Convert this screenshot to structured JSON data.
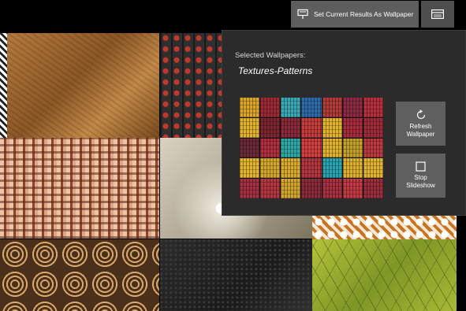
{
  "toolbar": {
    "set_wallpaper_label": "Set Current Results As Wallpaper",
    "set_wallpaper_icon": "monitor-pin-icon",
    "panel_icon": "panel-toggle-icon"
  },
  "flyout": {
    "label": "Selected Wallpapers:",
    "collection_name": "Textures-Patterns",
    "refresh_label": "Refresh Wallpaper",
    "refresh_icon": "refresh-icon",
    "stop_label": "Stop Slideshow",
    "stop_icon": "stop-icon",
    "thumbnail_colors": [
      "#d9a428",
      "#9b2a35",
      "#3aa7b5",
      "#2d6aa8",
      "#b23a3a",
      "#8d2a44",
      "#b52f3e",
      "#e0b02e",
      "#7d2530",
      "#8a2a3a",
      "#c43c3c",
      "#e2b12e",
      "#a52d3e",
      "#9e2b3a",
      "#6a2a3a",
      "#b02f3e",
      "#2ea7a5",
      "#d23f3f",
      "#e0b02e",
      "#c2a02a",
      "#bb3a40",
      "#e3b52f",
      "#d4a72c",
      "#d7aa2e",
      "#b23640",
      "#2aa3b0",
      "#dcb02f",
      "#e1b331",
      "#a33040",
      "#b33540",
      "#d0a32d",
      "#8b2b3a",
      "#a8303f",
      "#c13a44",
      "#9a2e3d"
    ]
  }
}
